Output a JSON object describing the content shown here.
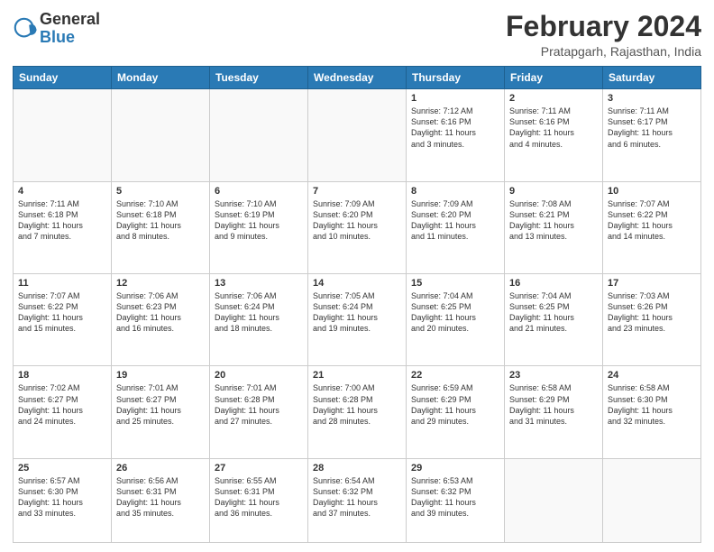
{
  "logo": {
    "general": "General",
    "blue": "Blue"
  },
  "title": "February 2024",
  "location": "Pratapgarh, Rajasthan, India",
  "days_of_week": [
    "Sunday",
    "Monday",
    "Tuesday",
    "Wednesday",
    "Thursday",
    "Friday",
    "Saturday"
  ],
  "weeks": [
    [
      {
        "day": "",
        "info": ""
      },
      {
        "day": "",
        "info": ""
      },
      {
        "day": "",
        "info": ""
      },
      {
        "day": "",
        "info": ""
      },
      {
        "day": "1",
        "info": "Sunrise: 7:12 AM\nSunset: 6:16 PM\nDaylight: 11 hours\nand 3 minutes."
      },
      {
        "day": "2",
        "info": "Sunrise: 7:11 AM\nSunset: 6:16 PM\nDaylight: 11 hours\nand 4 minutes."
      },
      {
        "day": "3",
        "info": "Sunrise: 7:11 AM\nSunset: 6:17 PM\nDaylight: 11 hours\nand 6 minutes."
      }
    ],
    [
      {
        "day": "4",
        "info": "Sunrise: 7:11 AM\nSunset: 6:18 PM\nDaylight: 11 hours\nand 7 minutes."
      },
      {
        "day": "5",
        "info": "Sunrise: 7:10 AM\nSunset: 6:18 PM\nDaylight: 11 hours\nand 8 minutes."
      },
      {
        "day": "6",
        "info": "Sunrise: 7:10 AM\nSunset: 6:19 PM\nDaylight: 11 hours\nand 9 minutes."
      },
      {
        "day": "7",
        "info": "Sunrise: 7:09 AM\nSunset: 6:20 PM\nDaylight: 11 hours\nand 10 minutes."
      },
      {
        "day": "8",
        "info": "Sunrise: 7:09 AM\nSunset: 6:20 PM\nDaylight: 11 hours\nand 11 minutes."
      },
      {
        "day": "9",
        "info": "Sunrise: 7:08 AM\nSunset: 6:21 PM\nDaylight: 11 hours\nand 13 minutes."
      },
      {
        "day": "10",
        "info": "Sunrise: 7:07 AM\nSunset: 6:22 PM\nDaylight: 11 hours\nand 14 minutes."
      }
    ],
    [
      {
        "day": "11",
        "info": "Sunrise: 7:07 AM\nSunset: 6:22 PM\nDaylight: 11 hours\nand 15 minutes."
      },
      {
        "day": "12",
        "info": "Sunrise: 7:06 AM\nSunset: 6:23 PM\nDaylight: 11 hours\nand 16 minutes."
      },
      {
        "day": "13",
        "info": "Sunrise: 7:06 AM\nSunset: 6:24 PM\nDaylight: 11 hours\nand 18 minutes."
      },
      {
        "day": "14",
        "info": "Sunrise: 7:05 AM\nSunset: 6:24 PM\nDaylight: 11 hours\nand 19 minutes."
      },
      {
        "day": "15",
        "info": "Sunrise: 7:04 AM\nSunset: 6:25 PM\nDaylight: 11 hours\nand 20 minutes."
      },
      {
        "day": "16",
        "info": "Sunrise: 7:04 AM\nSunset: 6:25 PM\nDaylight: 11 hours\nand 21 minutes."
      },
      {
        "day": "17",
        "info": "Sunrise: 7:03 AM\nSunset: 6:26 PM\nDaylight: 11 hours\nand 23 minutes."
      }
    ],
    [
      {
        "day": "18",
        "info": "Sunrise: 7:02 AM\nSunset: 6:27 PM\nDaylight: 11 hours\nand 24 minutes."
      },
      {
        "day": "19",
        "info": "Sunrise: 7:01 AM\nSunset: 6:27 PM\nDaylight: 11 hours\nand 25 minutes."
      },
      {
        "day": "20",
        "info": "Sunrise: 7:01 AM\nSunset: 6:28 PM\nDaylight: 11 hours\nand 27 minutes."
      },
      {
        "day": "21",
        "info": "Sunrise: 7:00 AM\nSunset: 6:28 PM\nDaylight: 11 hours\nand 28 minutes."
      },
      {
        "day": "22",
        "info": "Sunrise: 6:59 AM\nSunset: 6:29 PM\nDaylight: 11 hours\nand 29 minutes."
      },
      {
        "day": "23",
        "info": "Sunrise: 6:58 AM\nSunset: 6:29 PM\nDaylight: 11 hours\nand 31 minutes."
      },
      {
        "day": "24",
        "info": "Sunrise: 6:58 AM\nSunset: 6:30 PM\nDaylight: 11 hours\nand 32 minutes."
      }
    ],
    [
      {
        "day": "25",
        "info": "Sunrise: 6:57 AM\nSunset: 6:30 PM\nDaylight: 11 hours\nand 33 minutes."
      },
      {
        "day": "26",
        "info": "Sunrise: 6:56 AM\nSunset: 6:31 PM\nDaylight: 11 hours\nand 35 minutes."
      },
      {
        "day": "27",
        "info": "Sunrise: 6:55 AM\nSunset: 6:31 PM\nDaylight: 11 hours\nand 36 minutes."
      },
      {
        "day": "28",
        "info": "Sunrise: 6:54 AM\nSunset: 6:32 PM\nDaylight: 11 hours\nand 37 minutes."
      },
      {
        "day": "29",
        "info": "Sunrise: 6:53 AM\nSunset: 6:32 PM\nDaylight: 11 hours\nand 39 minutes."
      },
      {
        "day": "",
        "info": ""
      },
      {
        "day": "",
        "info": ""
      }
    ]
  ]
}
